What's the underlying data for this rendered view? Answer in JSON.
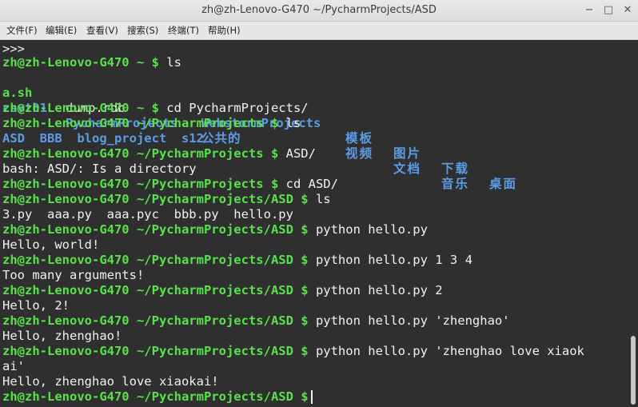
{
  "window": {
    "title": "zh@zh-Lenovo-G470 ~/PycharmProjects/ASD",
    "minimize_glyph": "−",
    "maximize_glyph": "□",
    "close_glyph": "✕"
  },
  "menu": [
    "文件(F)",
    "编辑(E)",
    "查看(V)",
    "搜索(S)",
    "终端(T)",
    "帮助(H)"
  ],
  "terminal": {
    "line_01": ">>>",
    "p1": "zh@zh-Lenovo-G470 ~ $",
    "c1": " ls",
    "ls1": {
      "a": "a.sh",
      "b": "dump.rdb",
      "c": "WebstormProjects",
      "d": "模板",
      "e": "图片",
      "f": "下载",
      "g": "桌面"
    },
    "ls2": {
      "a": "csvt01",
      "b": "PycharmProjects",
      "c": "公共的",
      "d": "视频",
      "e": "文档",
      "f": "音乐"
    },
    "p2": "zh@zh-Lenovo-G470 ~ $",
    "c2": " cd PycharmProjects/",
    "p3": "zh@zh-Lenovo-G470 ~/PycharmProjects $",
    "c3": " ls",
    "ls3": "ASD  BBB  blog_project  s12",
    "p4": "zh@zh-Lenovo-G470 ~/PycharmProjects $",
    "c4": " ASD/",
    "o4": "bash: ASD/: Is a directory",
    "p5": "zh@zh-Lenovo-G470 ~/PycharmProjects $",
    "c5": " cd ASD/",
    "p6": "zh@zh-Lenovo-G470 ~/PycharmProjects/ASD $",
    "c6": " ls",
    "o6": "3.py  aaa.py  aaa.pyc  bbb.py  hello.py",
    "p7": "zh@zh-Lenovo-G470 ~/PycharmProjects/ASD $",
    "c7": " python hello.py",
    "o7": "Hello, world!",
    "p8": "zh@zh-Lenovo-G470 ~/PycharmProjects/ASD $",
    "c8": " python hello.py 1 3 4",
    "o8": "Too many arguments!",
    "p9": "zh@zh-Lenovo-G470 ~/PycharmProjects/ASD $",
    "c9": " python hello.py 2",
    "o9": "Hello, 2!",
    "p10": "zh@zh-Lenovo-G470 ~/PycharmProjects/ASD $",
    "c10": " python hello.py 'zhenghao'",
    "o10": "Hello, zhenghao!",
    "p11": "zh@zh-Lenovo-G470 ~/PycharmProjects/ASD $",
    "c11": " python hello.py 'zhenghao love xiaok",
    "c11b": "ai'",
    "o11": "Hello, zhenghao love xiaokai!",
    "p12": "zh@zh-Lenovo-G470 ~/PycharmProjects/ASD $"
  },
  "colors": {
    "prompt": "#59e14b",
    "directory": "#5b9ce6",
    "background": "#2f2f2f",
    "text": "#f1f1f1"
  }
}
